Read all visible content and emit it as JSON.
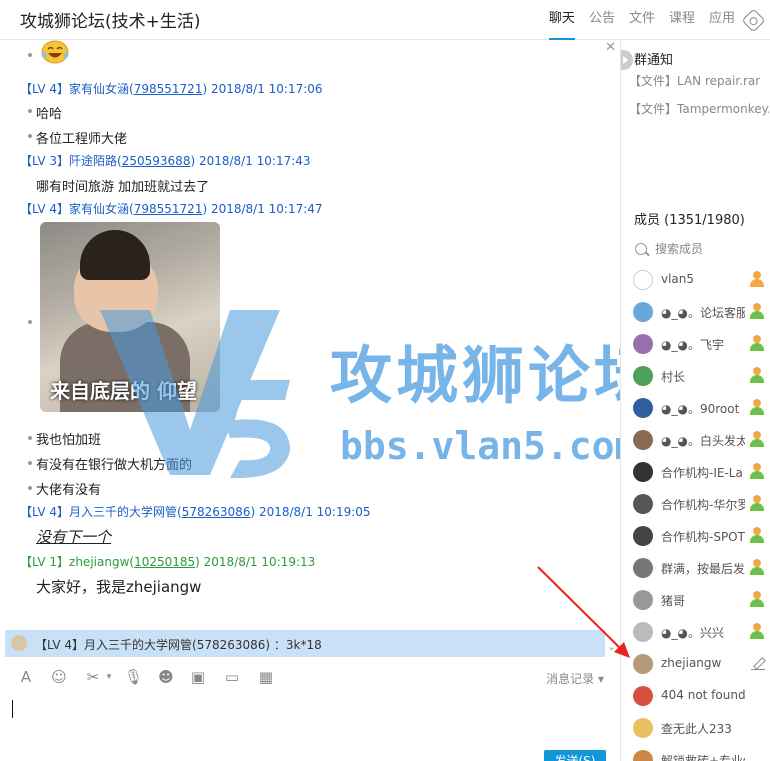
{
  "window": {
    "title": "攻城狮论坛(技术+生活)"
  },
  "tabs": [
    {
      "label": "聊天",
      "active": true
    },
    {
      "label": "公告",
      "active": false
    },
    {
      "label": "文件",
      "active": false
    },
    {
      "label": "课程",
      "active": false
    },
    {
      "label": "应用",
      "active": false
    }
  ],
  "chat": {
    "messages": [
      {
        "level": "【LV 4】",
        "user": "家有仙女涵",
        "qq": "798551721",
        "time": "2018/8/1 10:17:06",
        "lines": [
          "哈哈",
          "各位工程师大佬"
        ]
      },
      {
        "level": "【LV 3】",
        "user": "阡途陌路",
        "qq": "250593688",
        "time": "2018/8/1 10:17:43",
        "lines": [
          "哪有时间旅游  加加班就过去了"
        ]
      },
      {
        "level": "【LV 4】",
        "user": "家有仙女涵",
        "qq": "798551721",
        "time": "2018/8/1 10:17:47",
        "lines": [],
        "image_caption": "来自底层的 仰望"
      },
      {
        "extra_lines": [
          "我也怕加班",
          "有没有在银行做大机方面的",
          "大佬有没有"
        ]
      },
      {
        "level": "【LV 4】",
        "user": "月入三千的大学网管",
        "qq": "578263086",
        "time": "2018/8/1 10:19:05",
        "lines": [
          "没有下一个"
        ]
      },
      {
        "level": "【LV 1】",
        "user": "zhejiangw",
        "qq": "10250185",
        "time": "2018/8/1 10:19:13",
        "lines": [
          "大家好，我是zhejiangw"
        ]
      }
    ],
    "watermark": {
      "title": "攻城狮论坛",
      "url": "bbs.vlan5.com"
    },
    "banner_text": "【LV 4】月入三千的大学网管(578263086) ：3k*18"
  },
  "toolbar": {
    "history_label": "消息记录 ▾",
    "send_label": "发送(S)"
  },
  "sidebar": {
    "notice_title": "群通知",
    "files": [
      "【文件】LAN repair.rar",
      "【文件】Tampermonkey..."
    ],
    "members_title": "成员 (1351/1980)",
    "search_placeholder": "搜索成员",
    "members": [
      {
        "name": "vlan5",
        "color": "#ffffff",
        "role": "owner"
      },
      {
        "name": "◕_◕。论坛客服",
        "color": "#6aa6d8",
        "role": "admin"
      },
      {
        "name": "◕_◕。飞宇",
        "color": "#9a6fb0",
        "role": "admin"
      },
      {
        "name": "村长",
        "color": "#4f9e5a",
        "role": "admin"
      },
      {
        "name": "◕_◕。90root",
        "color": "#2f5f9f",
        "role": "admin"
      },
      {
        "name": "◕_◕。白头发太",
        "color": "#8a6a50",
        "role": "admin"
      },
      {
        "name": "合作机构-IE-La",
        "color": "#333333",
        "role": "admin"
      },
      {
        "name": "合作机构-华尔罗",
        "color": "#555555",
        "role": "admin"
      },
      {
        "name": "合作机构-SPOT",
        "color": "#444444",
        "role": "admin"
      },
      {
        "name": "群满，按最后发",
        "color": "#777777",
        "role": "admin"
      },
      {
        "name": "猪哥",
        "color": "#999999",
        "role": "admin"
      },
      {
        "name": "◕_◕。兴兴",
        "color": "#bbbbbb",
        "role": "admin"
      },
      {
        "name": "zhejiangw",
        "color": "#b49a7a",
        "role": "self"
      },
      {
        "name": "404 not found",
        "color": "#d85040",
        "role": "none"
      },
      {
        "name": "查无此人233",
        "color": "#e8c060",
        "role": "none"
      },
      {
        "name": "解锁救砖+专业修电",
        "color": "#cc8844",
        "role": "none"
      }
    ]
  }
}
